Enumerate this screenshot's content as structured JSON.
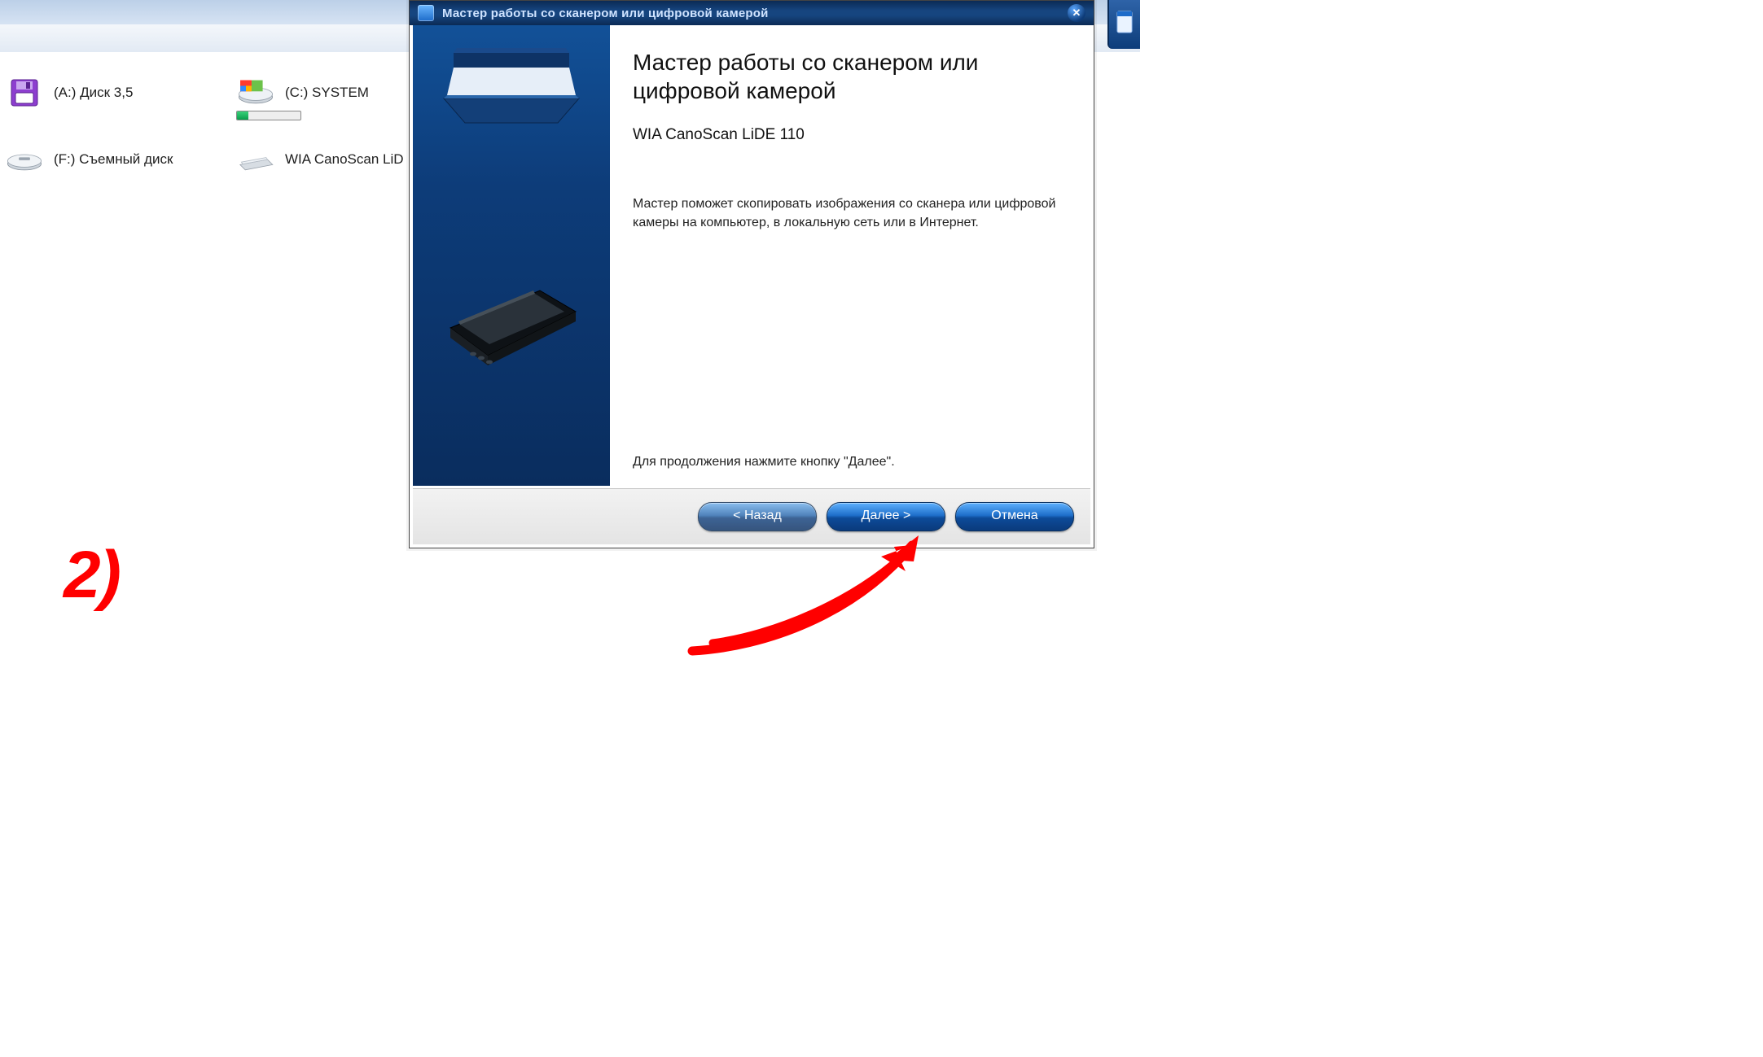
{
  "explorer": {
    "drives": [
      {
        "label": "(A:) Диск 3,5",
        "icon": "floppy-icon"
      },
      {
        "label": "(C:) SYSTEM",
        "icon": "hdd-icon",
        "capacity_pct": 18
      },
      {
        "label": "(F:) Съемный диск",
        "icon": "removable-icon"
      },
      {
        "label": "WIA CanoScan LiD",
        "icon": "scanner-icon"
      }
    ]
  },
  "wizard": {
    "window_title": "Мастер работы со сканером или цифровой камерой",
    "heading": "Мастер работы со сканером или цифровой камерой",
    "device_name": "WIA CanoScan LiDE 110",
    "intro_text": "Мастер поможет скопировать изображения со сканера или цифровой камеры на компьютер, в локальную сеть или в Интернет.",
    "continue_text": "Для продолжения нажмите кнопку \"Далее\".",
    "buttons": {
      "back": "< Назад",
      "next": "Далее >",
      "cancel": "Отмена"
    }
  },
  "annotation": {
    "step": "2)"
  }
}
